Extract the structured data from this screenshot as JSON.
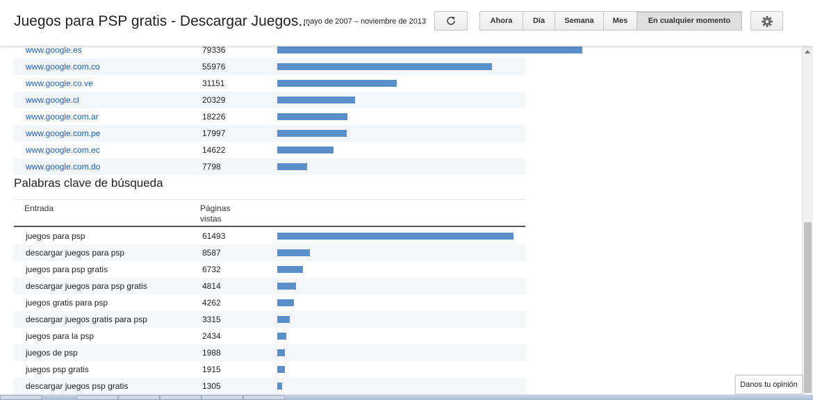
{
  "header": {
    "title": "Juegos para PSP gratis - Descargar Juegos...",
    "date_range": "mayo de 2007 – noviembre de 2013",
    "refresh_icon": "refresh-icon",
    "settings_icon": "gear-icon",
    "range_buttons": [
      {
        "label": "Ahora",
        "active": false
      },
      {
        "label": "Día",
        "active": false
      },
      {
        "label": "Semana",
        "active": false
      },
      {
        "label": "Mes",
        "active": false
      },
      {
        "label": "En cualquier momento",
        "active": true
      }
    ]
  },
  "referrers": [
    {
      "site": "www.google.es",
      "views": "79336"
    },
    {
      "site": "www.google.com.co",
      "views": "55976"
    },
    {
      "site": "www.google.co.ve",
      "views": "31151"
    },
    {
      "site": "www.google.cl",
      "views": "20329"
    },
    {
      "site": "www.google.com.ar",
      "views": "18226"
    },
    {
      "site": "www.google.com.pe",
      "views": "17997"
    },
    {
      "site": "www.google.com.ec",
      "views": "14622"
    },
    {
      "site": "www.google.com.do",
      "views": "7798"
    }
  ],
  "keywords_section": {
    "title": "Palabras clave de búsqueda",
    "col_entry": "Entrada",
    "col_views": "Páginas vistas",
    "rows": [
      {
        "term": "juegos para psp",
        "views": "61493"
      },
      {
        "term": "descargar juegos para psp",
        "views": "8587"
      },
      {
        "term": "juegos para psp gratis",
        "views": "6732"
      },
      {
        "term": "descargar juegos para psp gratis",
        "views": "4814"
      },
      {
        "term": "juegos gratis para psp",
        "views": "4262"
      },
      {
        "term": "descargar juegos gratis para psp",
        "views": "3315"
      },
      {
        "term": "juegos para la psp",
        "views": "2434"
      },
      {
        "term": "juegos de psp",
        "views": "1988"
      },
      {
        "term": "juegos psp gratis",
        "views": "1915"
      },
      {
        "term": "descargar juegos psp gratis",
        "views": "1305"
      }
    ]
  },
  "feedback": {
    "label": "Danos tu opinión"
  },
  "colors": {
    "bar": "#5b8fc9",
    "link": "#1a5fb4",
    "row_alt": "#f4f6fa"
  }
}
